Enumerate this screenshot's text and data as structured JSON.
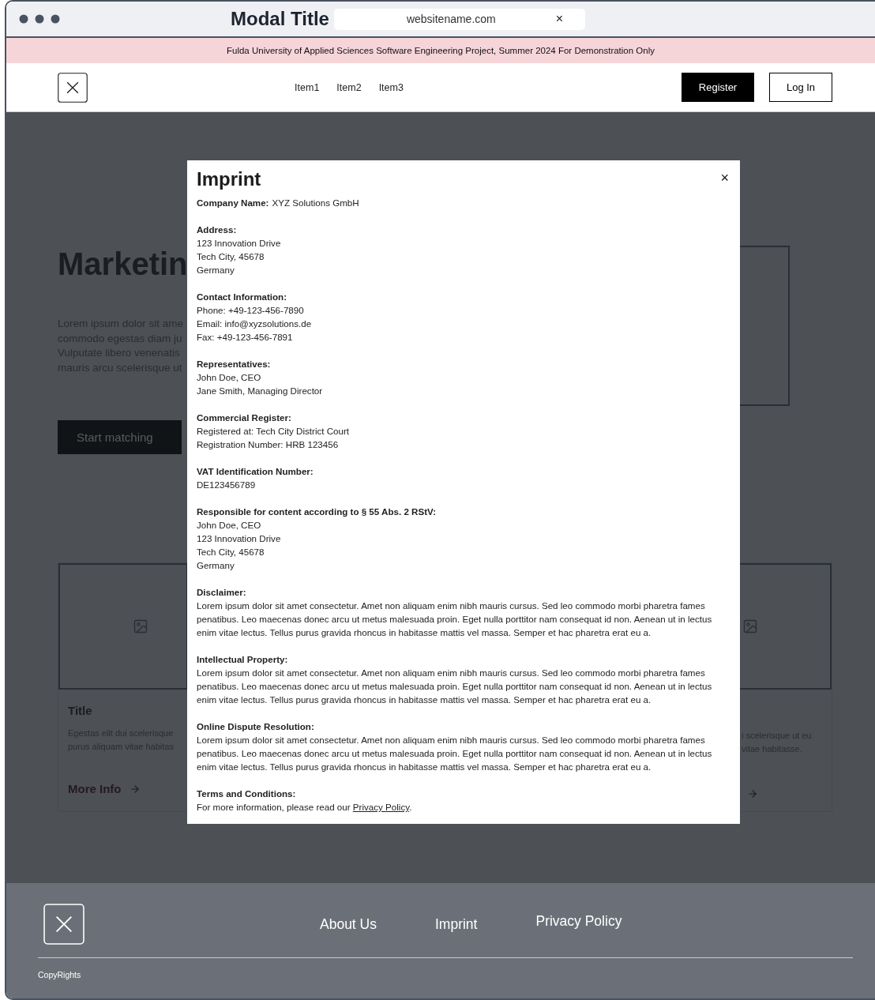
{
  "browser": {
    "title": "Modal Title",
    "url": "websitename.com",
    "close": "×"
  },
  "banner": "Fulda University of Applied Sciences Software Engineering Project, Summer 2024 For Demonstration Only",
  "nav": {
    "items": [
      "Item1",
      "Item2",
      "Item3"
    ],
    "register": "Register",
    "login": "Log In"
  },
  "hero": {
    "title": "Marketin",
    "text_lines": [
      "Lorem ipsum dolor sit ame",
      "commodo egestas diam ju",
      "Vulputate libero venenatis",
      "mauris arcu scelerisque ut"
    ],
    "button": "Start matching"
  },
  "cards": [
    {
      "title": "Title",
      "text_lines": [
        "Egestas elit dui scelerisque",
        "purus aliquam vitae habitas"
      ],
      "link": "More Info"
    },
    {
      "text_lines": [
        "i scelerisque ut eu",
        "vitae habitasse."
      ]
    }
  ],
  "modal": {
    "title": "Imprint",
    "close": "×",
    "sections": [
      {
        "kind": "inline",
        "heading": "Company Name:",
        "value": "XYZ Solutions GmbH"
      },
      {
        "kind": "lines",
        "heading": "Address:",
        "lines": [
          "123 Innovation Drive",
          "Tech City, 45678",
          "Germany"
        ]
      },
      {
        "kind": "lines",
        "heading": "Contact Information:",
        "lines": [
          "Phone: +49-123-456-7890",
          "Email: info@xyzsolutions.de",
          "Fax: +49-123-456-7891"
        ]
      },
      {
        "kind": "lines",
        "heading": "Representatives:",
        "lines": [
          "John Doe, CEO",
          "Jane Smith, Managing Director"
        ]
      },
      {
        "kind": "lines",
        "heading": "Commercial Register:",
        "lines": [
          "Registered at: Tech City District Court",
          "Registration Number: HRB 123456"
        ]
      },
      {
        "kind": "lines",
        "heading": "VAT Identification Number:",
        "lines": [
          "DE123456789"
        ]
      },
      {
        "kind": "lines",
        "heading": "Responsible for content according to § 55 Abs. 2 RStV:",
        "lines": [
          "John Doe, CEO",
          "123 Innovation Drive",
          "Tech City, 45678",
          "Germany"
        ]
      },
      {
        "kind": "paragraph",
        "heading": "Disclaimer:",
        "text": "Lorem ipsum dolor sit amet consectetur. Amet non aliquam enim nibh mauris cursus. Sed leo commodo morbi pharetra fames penatibus. Leo maecenas donec arcu ut metus malesuada proin. Eget nulla porttitor nam consequat id non. Aenean ut in lectus enim vitae lectus. Tellus purus gravida rhoncus in habitasse mattis vel massa. Semper et hac pharetra erat eu a."
      },
      {
        "kind": "paragraph",
        "heading": "Intellectual Property:",
        "text": "Lorem ipsum dolor sit amet consectetur. Amet non aliquam enim nibh mauris cursus. Sed leo commodo morbi pharetra fames penatibus. Leo maecenas donec arcu ut metus malesuada proin. Eget nulla porttitor nam consequat id non. Aenean ut in lectus enim vitae lectus. Tellus purus gravida rhoncus in habitasse mattis vel massa. Semper et hac pharetra erat eu a."
      },
      {
        "kind": "paragraph",
        "heading": "Online Dispute Resolution:",
        "text": "Lorem ipsum dolor sit amet consectetur. Amet non aliquam enim nibh mauris cursus. Sed leo commodo morbi pharetra fames penatibus. Leo maecenas donec arcu ut metus malesuada proin. Eget nulla porttitor nam consequat id non. Aenean ut in lectus enim vitae lectus. Tellus purus gravida rhoncus in habitasse mattis vel massa. Semper et hac pharetra erat eu a."
      },
      {
        "kind": "link",
        "heading": "Terms and Conditions:",
        "before": "For more information, please read our ",
        "link": "Privacy Policy",
        "after": "."
      }
    ]
  },
  "footer": {
    "links": [
      "About Us",
      "Imprint",
      "Privacy Policy"
    ],
    "copyright": "CopyRights"
  }
}
